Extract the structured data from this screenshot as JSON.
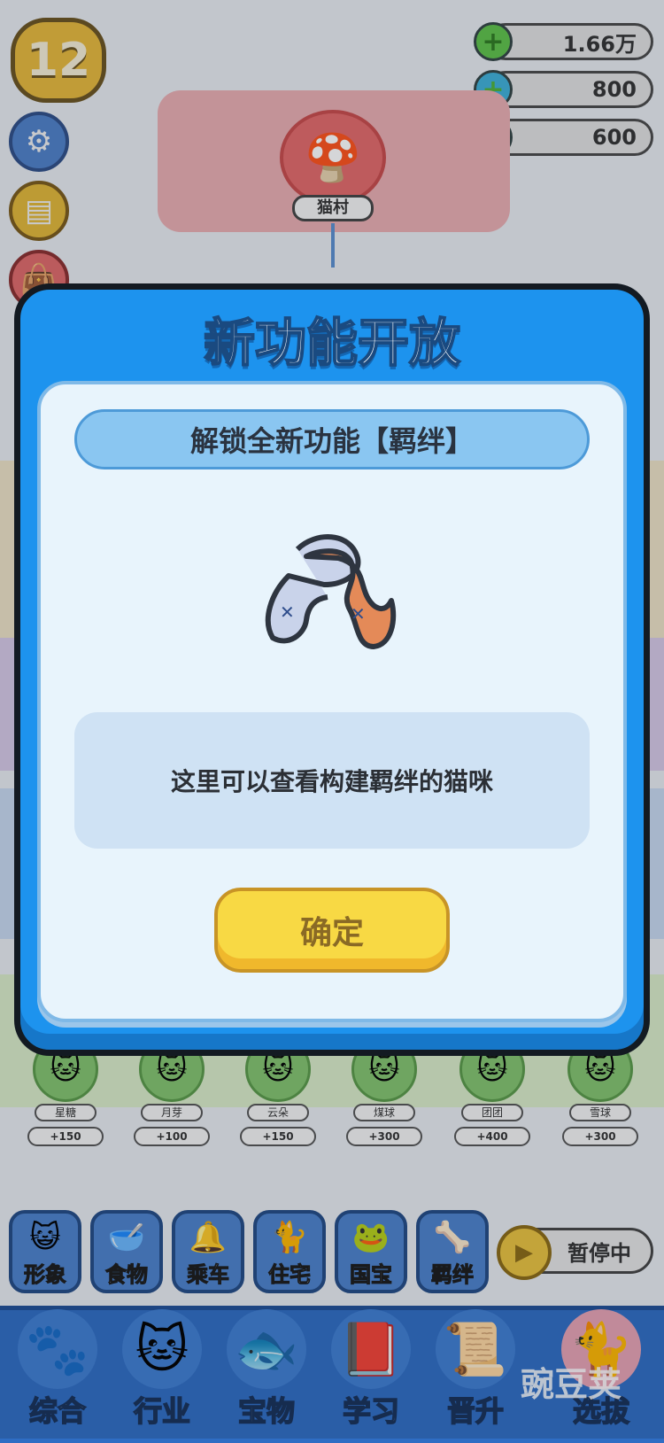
{
  "hud": {
    "level": "12",
    "resources": [
      {
        "icon": "cash-plus-icon",
        "value": "1.66万"
      },
      {
        "icon": "diamond-plus-icon",
        "value": "800"
      },
      {
        "icon": "gold-plus-icon",
        "value": "600"
      }
    ]
  },
  "map": {
    "village_label": "猫村"
  },
  "workers": [
    {
      "name": "星糖",
      "pay": "+150"
    },
    {
      "name": "月芽",
      "pay": "+100"
    },
    {
      "name": "云朵",
      "pay": "+150"
    },
    {
      "name": "煤球",
      "pay": "+300"
    },
    {
      "name": "团团",
      "pay": "+400"
    },
    {
      "name": "雪球",
      "pay": "+300"
    }
  ],
  "categories": [
    {
      "label": "形象",
      "icon": "cat-face-icon"
    },
    {
      "label": "食物",
      "icon": "food-bowl-icon"
    },
    {
      "label": "乘车",
      "icon": "bell-icon"
    },
    {
      "label": "住宅",
      "icon": "house-cat-icon"
    },
    {
      "label": "国宝",
      "icon": "green-cat-icon"
    },
    {
      "label": "羁绊",
      "icon": "bond-icon"
    }
  ],
  "pause": {
    "label": "暂停中"
  },
  "nav": [
    {
      "label": "综合",
      "icon": "paw-icon"
    },
    {
      "label": "行业",
      "icon": "cat-icon"
    },
    {
      "label": "宝物",
      "icon": "fish-cake-icon"
    },
    {
      "label": "学习",
      "icon": "book-icon"
    },
    {
      "label": "晋升",
      "icon": "promotion-icon"
    },
    {
      "label": "选拔",
      "icon": "cat-bed-icon"
    }
  ],
  "modal": {
    "title": "新功能开放",
    "subtitle": "解锁全新功能【羁绊】",
    "description": "这里可以查看构建羁绊的猫咪",
    "confirm": "确定"
  },
  "watermark": "豌豆荚"
}
